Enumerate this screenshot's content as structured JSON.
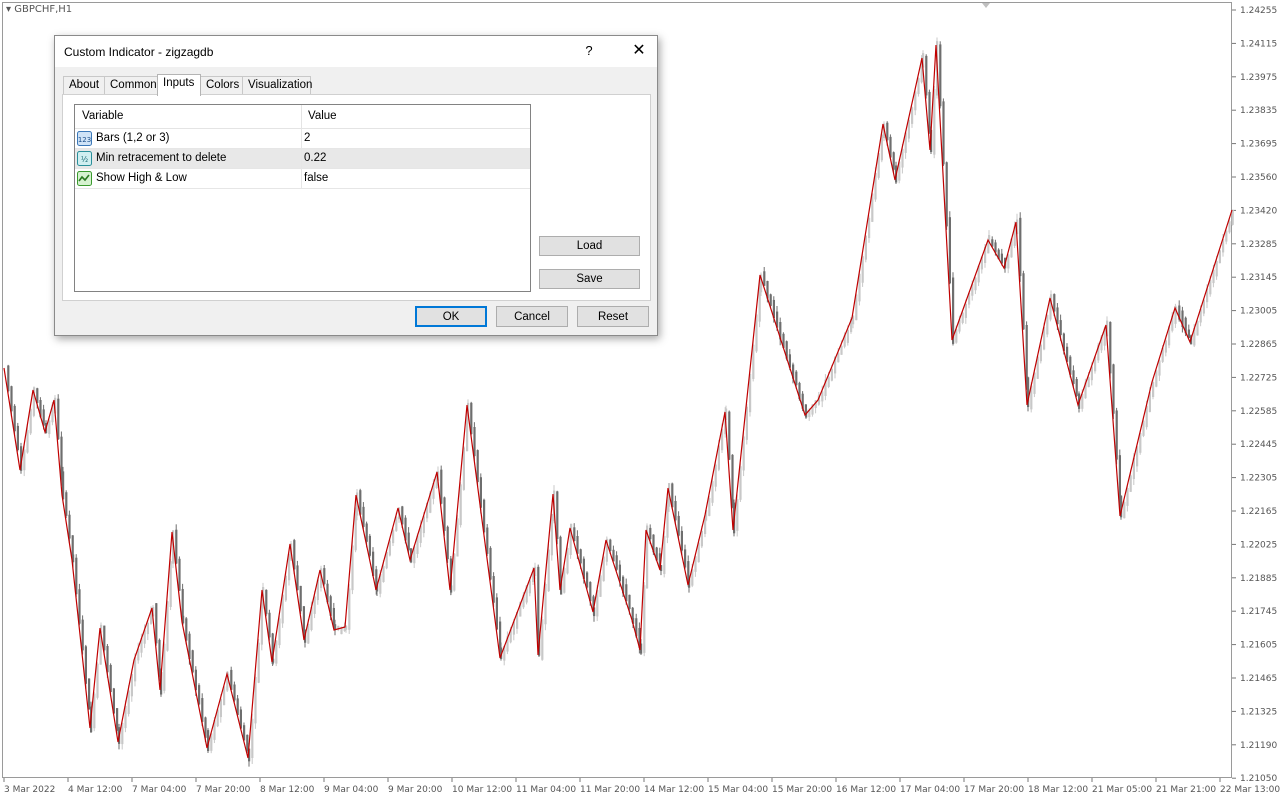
{
  "chart": {
    "symbol": "GBPCHF,H1",
    "price_ticks": [
      "1.24255",
      "1.24115",
      "1.23975",
      "1.23835",
      "1.23695",
      "1.23560",
      "1.23420",
      "1.23285",
      "1.23145",
      "1.23005",
      "1.22865",
      "1.22725",
      "1.22585",
      "1.22445",
      "1.22305",
      "1.22165",
      "1.22025",
      "1.21885",
      "1.21745",
      "1.21605",
      "1.21465",
      "1.21325",
      "1.21190",
      "1.21050"
    ],
    "time_ticks": [
      "3 Mar 2022",
      "4 Mar 12:00",
      "7 Mar 04:00",
      "7 Mar 20:00",
      "8 Mar 12:00",
      "9 Mar 04:00",
      "9 Mar 20:00",
      "10 Mar 12:00",
      "11 Mar 04:00",
      "11 Mar 20:00",
      "14 Mar 12:00",
      "15 Mar 04:00",
      "15 Mar 20:00",
      "16 Mar 12:00",
      "17 Mar 04:00",
      "17 Mar 20:00",
      "18 Mar 12:00",
      "21 Mar 05:00",
      "21 Mar 21:00",
      "22 Mar 13:00"
    ],
    "colors": {
      "zigzag": "#c00000",
      "candle_bull": "#c8c8c8",
      "candle_bear": "#6e6e6e",
      "axis": "#555555"
    }
  },
  "dialog": {
    "title": "Custom Indicator - zigzagdb",
    "help_label": "?",
    "close_label": "✕",
    "tabs": [
      {
        "label": "About"
      },
      {
        "label": "Common"
      },
      {
        "label": "Inputs"
      },
      {
        "label": "Colors"
      },
      {
        "label": "Visualization"
      }
    ],
    "grid": {
      "col_variable": "Variable",
      "col_value": "Value",
      "rows": [
        {
          "icon": "integer-icon",
          "name": "Bars (1,2 or 3)",
          "value": "2"
        },
        {
          "icon": "double-icon",
          "name": "Min retracement to delete",
          "value": "0.22"
        },
        {
          "icon": "bool-icon",
          "name": "Show High & Low",
          "value": "false"
        }
      ]
    },
    "load_label": "Load",
    "save_label": "Save",
    "ok_label": "OK",
    "cancel_label": "Cancel",
    "reset_label": "Reset"
  }
}
